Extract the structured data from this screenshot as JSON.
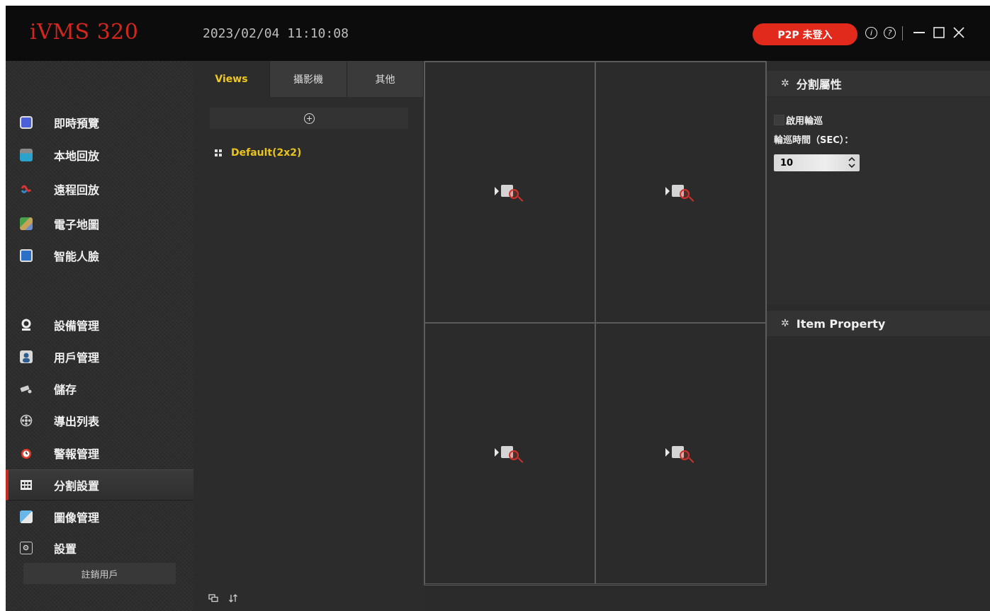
{
  "app": {
    "title": "iVMS 320",
    "datetime": "2023/02/04 11:10:08",
    "p2p_button": "P2P 未登入",
    "info_icon": "i",
    "help_icon": "?"
  },
  "colors": {
    "brand_red": "#d3271d",
    "accent_yellow": "#f2c91c",
    "active_border": "#c62a1f"
  },
  "sidebar": {
    "items": [
      {
        "label": "即時預覽",
        "icon": "live-view-icon"
      },
      {
        "label": "本地回放",
        "icon": "local-playback-icon"
      },
      {
        "label": "遠程回放",
        "icon": "remote-playback-icon"
      },
      {
        "label": "電子地圖",
        "icon": "emap-icon"
      },
      {
        "label": "智能人臉",
        "icon": "face-recognition-icon"
      },
      {
        "label": "設備管理",
        "icon": "device-management-icon"
      },
      {
        "label": "用戶管理",
        "icon": "user-management-icon"
      },
      {
        "label": "儲存",
        "icon": "storage-icon"
      },
      {
        "label": "導出列表",
        "icon": "export-list-icon"
      },
      {
        "label": "警報管理",
        "icon": "alarm-management-icon"
      },
      {
        "label": "分割設置",
        "icon": "split-settings-icon"
      },
      {
        "label": "圖像管理",
        "icon": "image-management-icon"
      },
      {
        "label": "設置",
        "icon": "settings-icon"
      }
    ],
    "active_label": "分割設置",
    "logout_label": "註銷用戶"
  },
  "views_panel": {
    "tabs": [
      "Views",
      "攝影機",
      "其他"
    ],
    "active_tab": "Views",
    "views": [
      {
        "label": "Default(2x2)"
      }
    ]
  },
  "properties": {
    "split_header": "分割屬性",
    "enable_tour_label": "啟用輪巡",
    "enable_tour_checked": false,
    "tour_time_label": "輪巡時間（SEC）：",
    "tour_time_value": "10",
    "item_header": "Item Property"
  }
}
